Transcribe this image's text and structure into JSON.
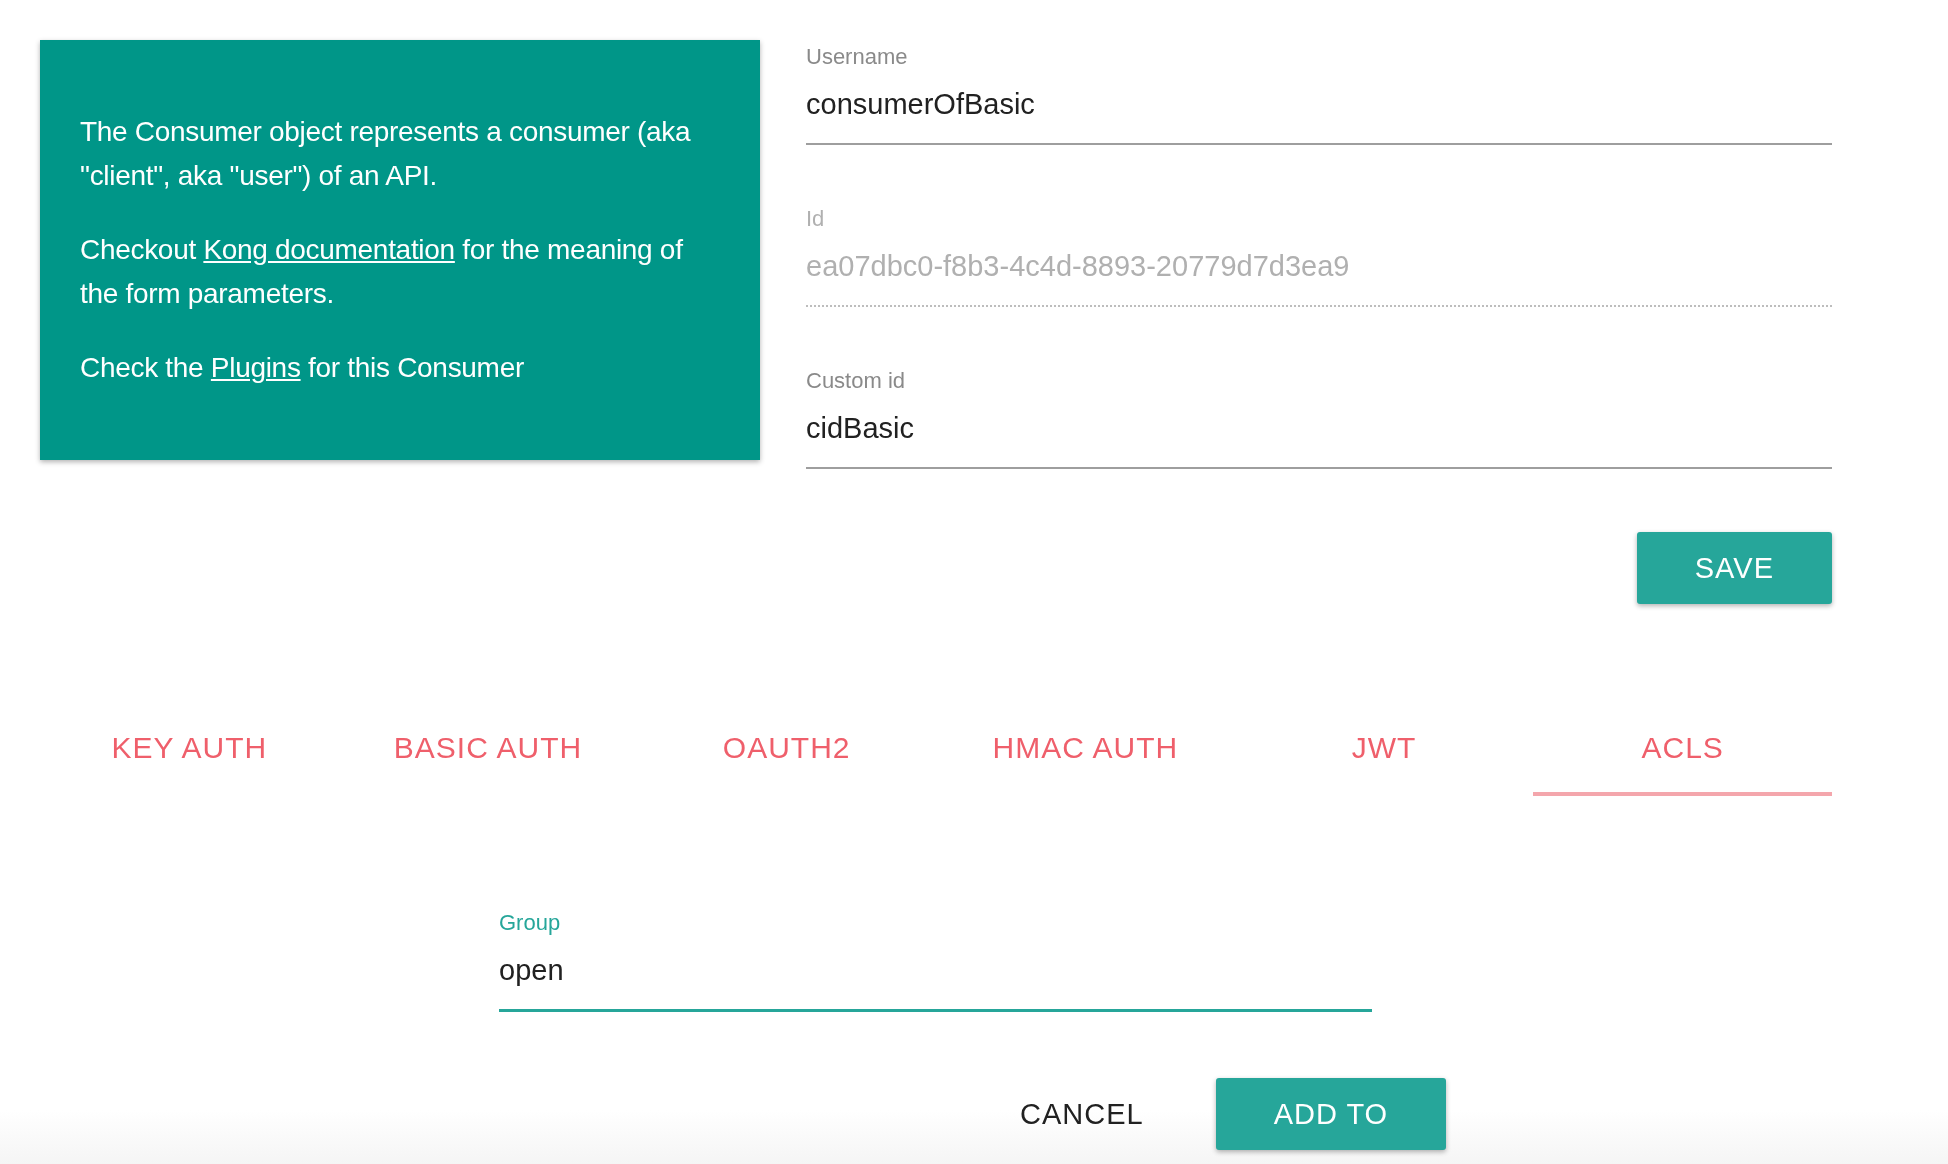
{
  "info_card": {
    "paragraphs": [
      [
        {
          "kind": "text",
          "text": "The Consumer object represents a consumer (aka \"client\", aka \"user\") of an API."
        }
      ],
      [
        {
          "kind": "text",
          "text": "Checkout "
        },
        {
          "kind": "link",
          "text": "Kong documentation"
        },
        {
          "kind": "text",
          "text": " for the meaning of the form parameters."
        }
      ],
      [
        {
          "kind": "text",
          "text": "Check the "
        },
        {
          "kind": "link",
          "text": "Plugins"
        },
        {
          "kind": "text",
          "text": " for this Consumer"
        }
      ]
    ]
  },
  "fields": [
    {
      "label": "Username",
      "value": "consumerOfBasic",
      "disabled": false
    },
    {
      "label": "Id",
      "value": "ea07dbc0-f8b3-4c4d-8893-20779d7d3ea9",
      "disabled": true
    },
    {
      "label": "Custom id",
      "value": "cidBasic",
      "disabled": false
    }
  ],
  "save_button": "SAVE",
  "tabs": [
    {
      "label": "KEY AUTH",
      "selected": false
    },
    {
      "label": "BASIC AUTH",
      "selected": false
    },
    {
      "label": "OAUTH2",
      "selected": false
    },
    {
      "label": "HMAC AUTH",
      "selected": false
    },
    {
      "label": "JWT",
      "selected": false
    },
    {
      "label": "ACLS",
      "selected": true
    }
  ],
  "group_field": {
    "label": "Group",
    "value": "open",
    "focused": true
  },
  "actions": {
    "cancel": "CANCEL",
    "submit": "ADD TO"
  }
}
